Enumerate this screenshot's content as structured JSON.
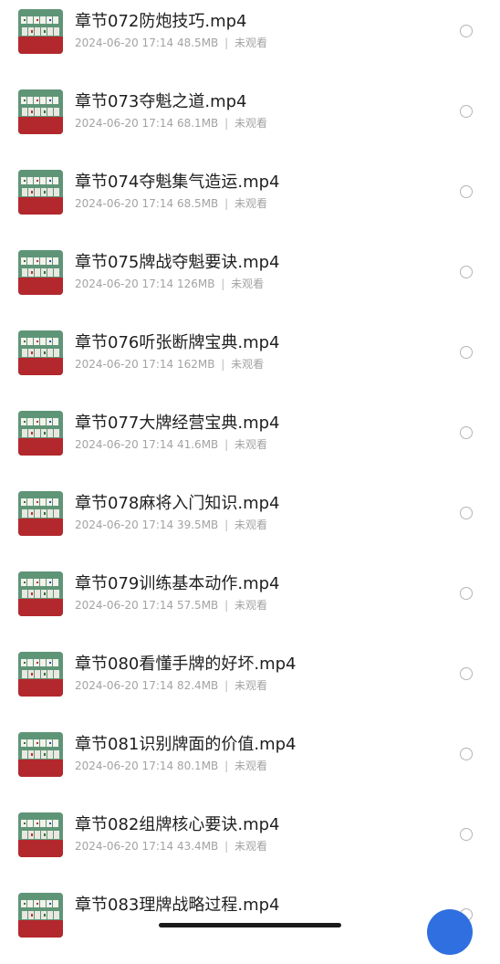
{
  "files": [
    {
      "name": "章节072防炮技巧.mp4",
      "date": "2024-06-20 17:14",
      "size": "48.5MB",
      "status": "未观看"
    },
    {
      "name": "章节073夺魁之道.mp4",
      "date": "2024-06-20 17:14",
      "size": "68.1MB",
      "status": "未观看"
    },
    {
      "name": "章节074夺魁集气造运.mp4",
      "date": "2024-06-20 17:14",
      "size": "68.5MB",
      "status": "未观看"
    },
    {
      "name": "章节075牌战夺魁要诀.mp4",
      "date": "2024-06-20 17:14",
      "size": "126MB",
      "status": "未观看"
    },
    {
      "name": "章节076听张断牌宝典.mp4",
      "date": "2024-06-20 17:14",
      "size": "162MB",
      "status": "未观看"
    },
    {
      "name": "章节077大牌经营宝典.mp4",
      "date": "2024-06-20 17:14",
      "size": "41.6MB",
      "status": "未观看"
    },
    {
      "name": "章节078麻将入门知识.mp4",
      "date": "2024-06-20 17:14",
      "size": "39.5MB",
      "status": "未观看"
    },
    {
      "name": "章节079训练基本动作.mp4",
      "date": "2024-06-20 17:14",
      "size": "57.5MB",
      "status": "未观看"
    },
    {
      "name": "章节080看懂手牌的好坏.mp4",
      "date": "2024-06-20 17:14",
      "size": "82.4MB",
      "status": "未观看"
    },
    {
      "name": "章节081识别牌面的价值.mp4",
      "date": "2024-06-20 17:14",
      "size": "80.1MB",
      "status": "未观看"
    },
    {
      "name": "章节082组牌核心要诀.mp4",
      "date": "2024-06-20 17:14",
      "size": "43.4MB",
      "status": "未观看"
    },
    {
      "name": "章节083理牌战略过程.mp4",
      "date": "",
      "size": "",
      "status": ""
    }
  ],
  "colors": {
    "title": "#1f1f1f",
    "meta": "#a3a3a3",
    "radio_border": "#b5b5b5",
    "fab": "#2f6fe0",
    "thumb_felt": "#5f9577",
    "thumb_table": "#b3282d"
  },
  "icons": {
    "thumbnail": "mahjong-video-thumbnail",
    "select": "radio-unchecked-icon"
  }
}
